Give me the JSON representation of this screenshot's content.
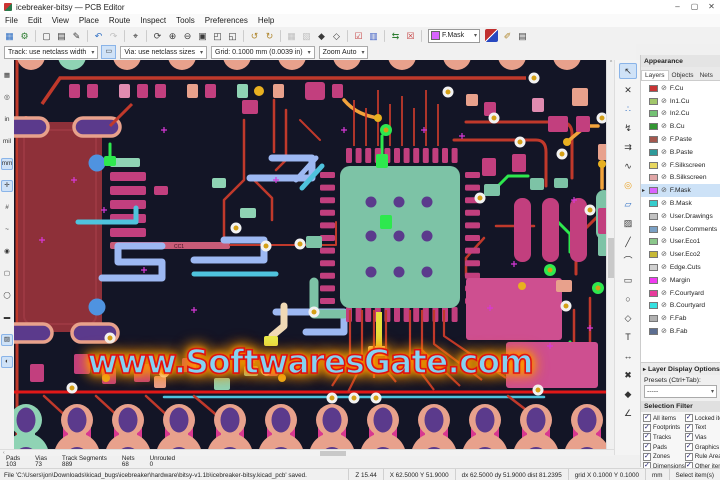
{
  "window": {
    "title": "icebreaker-bitsy — PCB Editor",
    "minimize": "–",
    "maximize": "▢",
    "close": "✕"
  },
  "menu": [
    "File",
    "Edit",
    "View",
    "Place",
    "Route",
    "Inspect",
    "Tools",
    "Preferences",
    "Help"
  ],
  "toolbar_main": {
    "icons": [
      {
        "name": "save-button",
        "glyph": "▦",
        "color": "#2f6fc4"
      },
      {
        "name": "board-setup-button",
        "glyph": "⚙",
        "color": "#2e7d32"
      },
      {
        "name": "toolbar-separator",
        "sep": true
      },
      {
        "name": "page-settings-button",
        "glyph": "▢"
      },
      {
        "name": "print-button",
        "glyph": "▤"
      },
      {
        "name": "plot-button",
        "glyph": "✎"
      },
      {
        "name": "toolbar-separator",
        "sep": true
      },
      {
        "name": "undo-button",
        "glyph": "↶",
        "color": "#2f6fc4"
      },
      {
        "name": "redo-button",
        "glyph": "↷",
        "dis": true
      },
      {
        "name": "toolbar-separator",
        "sep": true
      },
      {
        "name": "find-button",
        "glyph": "⌖"
      },
      {
        "name": "toolbar-separator",
        "sep": true
      },
      {
        "name": "refresh-button",
        "glyph": "⟳"
      },
      {
        "name": "zoom-in-button",
        "glyph": "⊕"
      },
      {
        "name": "zoom-out-button",
        "glyph": "⊖"
      },
      {
        "name": "zoom-fit-button",
        "glyph": "▣"
      },
      {
        "name": "zoom-to-objects-button",
        "glyph": "◰"
      },
      {
        "name": "zoom-to-selection-button",
        "glyph": "◱"
      },
      {
        "name": "toolbar-separator",
        "sep": true
      },
      {
        "name": "rotate-ccw-button",
        "glyph": "↺",
        "color": "#b0872f"
      },
      {
        "name": "rotate-cw-button",
        "glyph": "↻",
        "color": "#b0872f"
      },
      {
        "name": "toolbar-separator",
        "sep": true
      },
      {
        "name": "group-button",
        "glyph": "▦",
        "dis": true
      },
      {
        "name": "ungroup-button",
        "glyph": "▧",
        "dis": true
      },
      {
        "name": "lock-button",
        "glyph": "◆"
      },
      {
        "name": "unlock-button",
        "glyph": "◇"
      },
      {
        "name": "toolbar-separator",
        "sep": true
      },
      {
        "name": "inspect-drc-schedule-button",
        "glyph": "☑",
        "color": "#c43c3c"
      },
      {
        "name": "footprint-compare-button",
        "glyph": "▥",
        "color": "#3c5cc4"
      },
      {
        "name": "toolbar-separator",
        "sep": true
      },
      {
        "name": "update-pcb-from-schematic-button",
        "glyph": "⇆",
        "color": "#2e7d32"
      },
      {
        "name": "run-drc-button",
        "glyph": "☒",
        "color": "#c43c3c"
      },
      {
        "name": "toolbar-separator",
        "sep": true
      }
    ],
    "layer_selector": {
      "label": "F.Mask",
      "swatch_color": "#d864ff"
    },
    "trailing": [
      {
        "name": "route-style-button",
        "glyph": "✐",
        "color": "#b0872f"
      },
      {
        "name": "scripting-console-button",
        "glyph": "▤",
        "color": "#444444"
      }
    ]
  },
  "toolbar_settings": {
    "track": "Track: use netclass width",
    "track_button_glyph": "▭",
    "via": "Via: use netclass sizes",
    "grid": "Grid: 0.1000 mm (0.0039 in)",
    "zoom": "Zoom Auto"
  },
  "left_toolbar": [
    {
      "name": "grid-visibility-icon",
      "glyph": "▦"
    },
    {
      "name": "polar-coords-icon",
      "glyph": "◎"
    },
    {
      "name": "units-inches-icon",
      "glyph": "in"
    },
    {
      "name": "units-mils-icon",
      "glyph": "mil"
    },
    {
      "name": "units-mm-icon",
      "glyph": "mm",
      "active": true
    },
    {
      "name": "crosshair-cursor-icon",
      "glyph": "✛",
      "active": true
    },
    {
      "name": "ratsnest-visibility-icon",
      "glyph": "#"
    },
    {
      "name": "curved-ratsnest-icon",
      "glyph": "~"
    },
    {
      "name": "net-highlight-icon",
      "glyph": "◉"
    },
    {
      "name": "sketch-pads-icon",
      "glyph": "▢"
    },
    {
      "name": "sketch-vias-icon",
      "glyph": "◯"
    },
    {
      "name": "sketch-tracks-icon",
      "glyph": "▬"
    },
    {
      "name": "sketch-zones-icon",
      "glyph": "▨",
      "active": true
    },
    {
      "name": "high-contrast-icon",
      "glyph": "◐",
      "active": true
    }
  ],
  "right_toolbar": [
    {
      "name": "select-tool-icon",
      "glyph": "↖",
      "active": true
    },
    {
      "name": "highlight-net-icon",
      "glyph": "✕"
    },
    {
      "name": "local-ratsnest-icon",
      "glyph": "∴",
      "color": "#2f6fc4"
    },
    {
      "name": "route-tracks-icon",
      "glyph": "↯"
    },
    {
      "name": "route-diff-pair-icon",
      "glyph": "⇉"
    },
    {
      "name": "tune-length-icon",
      "glyph": "∿"
    },
    {
      "name": "add-via-icon",
      "glyph": "◎",
      "color": "#e8a020"
    },
    {
      "name": "add-zone-icon",
      "glyph": "▱",
      "color": "#2f6fc4"
    },
    {
      "name": "add-keepout-icon",
      "glyph": "▨"
    },
    {
      "name": "draw-line-icon",
      "glyph": "╱"
    },
    {
      "name": "draw-arc-icon",
      "glyph": "⌒"
    },
    {
      "name": "draw-rectangle-icon",
      "glyph": "▭"
    },
    {
      "name": "draw-circle-icon",
      "glyph": "○"
    },
    {
      "name": "draw-polygon-icon",
      "glyph": "◇"
    },
    {
      "name": "add-text-icon",
      "glyph": "T"
    },
    {
      "name": "add-dimension-icon",
      "glyph": "↔"
    },
    {
      "name": "delete-tool-icon",
      "glyph": "✖"
    },
    {
      "name": "grid-origin-icon",
      "glyph": "◆"
    },
    {
      "name": "measure-tool-icon",
      "glyph": "∠"
    }
  ],
  "canvas": {
    "watermark": "www.SoftwaresGate.com",
    "cc1_label": "CC1"
  },
  "appearance": {
    "title": "Appearance",
    "tabs": [
      {
        "label": "Layers",
        "active": true
      },
      {
        "label": "Objects"
      },
      {
        "label": "Nets"
      }
    ],
    "layers": [
      {
        "name": "F.Cu",
        "color": "#c83434"
      },
      {
        "name": "In1.Cu",
        "color": "#a2c76b"
      },
      {
        "name": "In2.Cu",
        "color": "#74c274"
      },
      {
        "name": "B.Cu",
        "color": "#339733"
      },
      {
        "name": "F.Paste",
        "color": "#a4584e"
      },
      {
        "name": "B.Paste",
        "color": "#2f9a9a"
      },
      {
        "name": "F.Silkscreen",
        "color": "#e8d760"
      },
      {
        "name": "B.Silkscreen",
        "color": "#e0a6a6"
      },
      {
        "name": "F.Mask",
        "color": "#d864ff",
        "selected": true
      },
      {
        "name": "B.Mask",
        "color": "#35cdcd"
      },
      {
        "name": "User.Drawings",
        "color": "#c2c2c2"
      },
      {
        "name": "User.Comments",
        "color": "#7aa0c4"
      },
      {
        "name": "User.Eco1",
        "color": "#8bc78b"
      },
      {
        "name": "User.Eco2",
        "color": "#c7b937"
      },
      {
        "name": "Edge.Cuts",
        "color": "#d0d0d0"
      },
      {
        "name": "Margin",
        "color": "#f03bf0"
      },
      {
        "name": "F.Courtyard",
        "color": "#e83b9c"
      },
      {
        "name": "B.Courtyard",
        "color": "#35e0e0"
      },
      {
        "name": "F.Fab",
        "color": "#b0b0b0"
      },
      {
        "name": "B.Fab",
        "color": "#5c6e91"
      }
    ],
    "layer_display_options": "Layer Display Options",
    "presets_label": "Presets (Ctrl+Tab):",
    "presets_value": "-----",
    "selection_filter": {
      "title": "Selection Filter",
      "items": [
        {
          "label": "All items",
          "checked": true
        },
        {
          "label": "Locked items",
          "checked": true
        },
        {
          "label": "Footprints",
          "checked": true
        },
        {
          "label": "Text",
          "checked": true
        },
        {
          "label": "Tracks",
          "checked": true
        },
        {
          "label": "Vias",
          "checked": true
        },
        {
          "label": "Pads",
          "checked": true
        },
        {
          "label": "Graphics",
          "checked": true
        },
        {
          "label": "Zones",
          "checked": true
        },
        {
          "label": "Rule Areas",
          "checked": true
        },
        {
          "label": "Dimensions",
          "checked": true
        },
        {
          "label": "Other items",
          "checked": true
        }
      ]
    }
  },
  "counts": [
    {
      "label": "Pads",
      "value": "103"
    },
    {
      "label": "Vias",
      "value": "73"
    },
    {
      "label": "Track Segments",
      "value": "889"
    },
    {
      "label": "Nets",
      "value": "68"
    },
    {
      "label": "Unrouted",
      "value": "0"
    }
  ],
  "statusbar": {
    "message": "File 'C:\\Users\\jon\\Downloads\\kicad_bugs\\icebreaker\\hardware\\bitsy-v1.1b\\icebreaker-bitsy.kicad_pcb' saved.",
    "zoom": "Z 15.44",
    "position": "X 62.5000 Y 51.9000",
    "delta": "dx 62.5000 dy 51.9000 dist 81.2395",
    "grid": "grid X 0.1000 Y 0.1000",
    "units": "mm",
    "mode": "Select item(s)"
  }
}
